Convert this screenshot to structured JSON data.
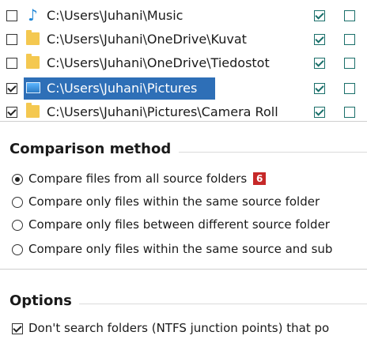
{
  "folders": [
    {
      "path": "C:\\Users\\Juhani\\Music",
      "icon": "music-note-icon",
      "checked": false,
      "col2": true,
      "col3": false
    },
    {
      "path": "C:\\Users\\Juhani\\OneDrive\\Kuvat",
      "icon": "folder-icon",
      "checked": false,
      "col2": true,
      "col3": false
    },
    {
      "path": "C:\\Users\\Juhani\\OneDrive\\Tiedostot",
      "icon": "folder-icon",
      "checked": false,
      "col2": true,
      "col3": false
    },
    {
      "path": "C:\\Users\\Juhani\\Pictures",
      "icon": "pictures-folder-icon",
      "checked": true,
      "col2": true,
      "col3": false,
      "selected": true
    },
    {
      "path": "C:\\Users\\Juhani\\Pictures\\Camera Roll",
      "icon": "folder-icon",
      "checked": true,
      "col2": true,
      "col3": false
    }
  ],
  "comparison": {
    "title": "Comparison method",
    "badge": "6",
    "options": [
      {
        "label": "Compare files from all source folders",
        "selected": true
      },
      {
        "label": "Compare only files within the same source folder",
        "selected": false
      },
      {
        "label": "Compare only files between different source folder",
        "selected": false
      },
      {
        "label": "Compare only files within the same source and sub",
        "selected": false
      }
    ]
  },
  "options": {
    "title": "Options",
    "checkbox_label": "Don't search folders (NTFS junction points) that po",
    "checked": true
  },
  "colors": {
    "selection": "#2e6fb7",
    "check_teal": "#1a6f6a",
    "badge": "#c62828",
    "folder": "#f4c850"
  }
}
